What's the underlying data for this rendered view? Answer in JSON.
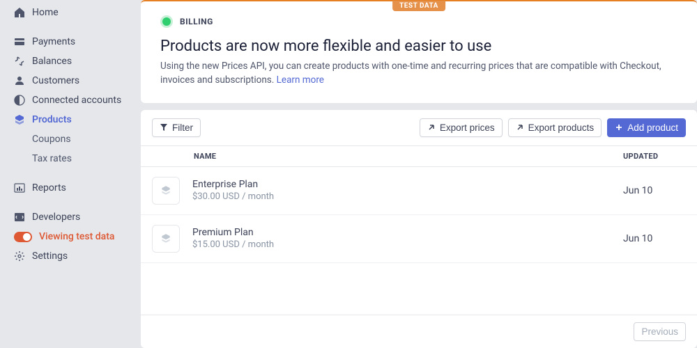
{
  "sidebar": {
    "home": "Home",
    "payments": "Payments",
    "balances": "Balances",
    "customers": "Customers",
    "connected": "Connected accounts",
    "products": "Products",
    "coupons": "Coupons",
    "taxrates": "Tax rates",
    "reports": "Reports",
    "developers": "Developers",
    "viewing_test": "Viewing test data",
    "settings": "Settings"
  },
  "banner": {
    "badge": "TEST DATA",
    "tag": "BILLING",
    "title": "Products are now more flexible and easier to use",
    "body": "Using the new Prices API, you can create products with one-time and recurring prices that are compatible with Checkout, invoices and subscriptions. ",
    "learn_more": "Learn more"
  },
  "toolbar": {
    "filter": "Filter",
    "export_prices": "Export prices",
    "export_products": "Export products",
    "add_product": "Add product"
  },
  "table": {
    "col_name": "NAME",
    "col_updated": "UPDATED",
    "rows": [
      {
        "name": "Enterprise Plan",
        "price": "$30.00 USD / month",
        "updated": "Jun 10"
      },
      {
        "name": "Premium Plan",
        "price": "$15.00 USD / month",
        "updated": "Jun 10"
      }
    ],
    "previous": "Previous"
  }
}
